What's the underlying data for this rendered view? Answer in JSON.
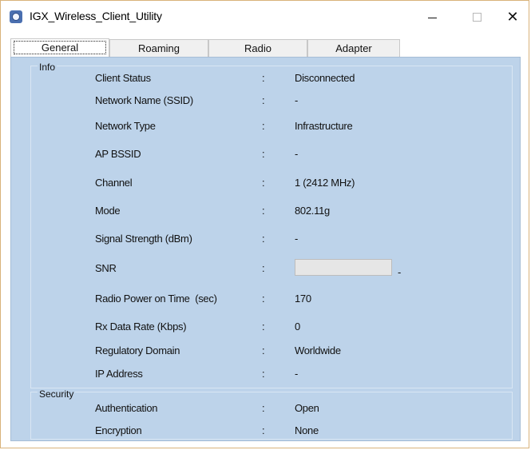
{
  "window": {
    "title": "IGX_Wireless_Client_Utility",
    "minimize_glyph": "—",
    "maximize_glyph": "□",
    "close_glyph": "✕"
  },
  "tabs": [
    {
      "label": "General",
      "active": true
    },
    {
      "label": "Roaming",
      "active": false
    },
    {
      "label": "Radio",
      "active": false
    },
    {
      "label": "Adapter",
      "active": false
    }
  ],
  "info": {
    "group_label": "Info",
    "rows": [
      {
        "label": "Client Status",
        "colon": ":",
        "value": "Disconnected"
      },
      {
        "label": "Network Name (SSID)",
        "colon": ":",
        "value": "-"
      },
      {
        "label": "Network Type",
        "colon": ":",
        "value": "Infrastructure"
      },
      {
        "label": "AP BSSID",
        "colon": ":",
        "value": "-"
      },
      {
        "label": "Channel",
        "colon": ":",
        "value": "1 (2412 MHz)"
      },
      {
        "label": "Mode",
        "colon": ":",
        "value": "802.11g"
      },
      {
        "label": "Signal Strength (dBm)",
        "colon": ":",
        "value": "-"
      },
      {
        "label": "SNR",
        "colon": ":",
        "value": "",
        "progress": 0,
        "suffix": "-"
      },
      {
        "label": "Radio Power on Time  (sec)",
        "colon": ":",
        "value": "170"
      },
      {
        "label": "Rx Data Rate (Kbps)",
        "colon": ":",
        "value": "0"
      },
      {
        "label": "Regulatory Domain",
        "colon": ":",
        "value": "Worldwide"
      },
      {
        "label": "IP Address",
        "colon": ":",
        "value": "-"
      }
    ]
  },
  "security": {
    "group_label": "Security",
    "rows": [
      {
        "label": "Authentication",
        "colon": ":",
        "value": "Open"
      },
      {
        "label": "Encryption",
        "colon": ":",
        "value": "None"
      }
    ]
  },
  "colors": {
    "panel_bg": "#bdd3ea",
    "group_border": "#d9e6f3",
    "progress_fill": "#06b025"
  }
}
